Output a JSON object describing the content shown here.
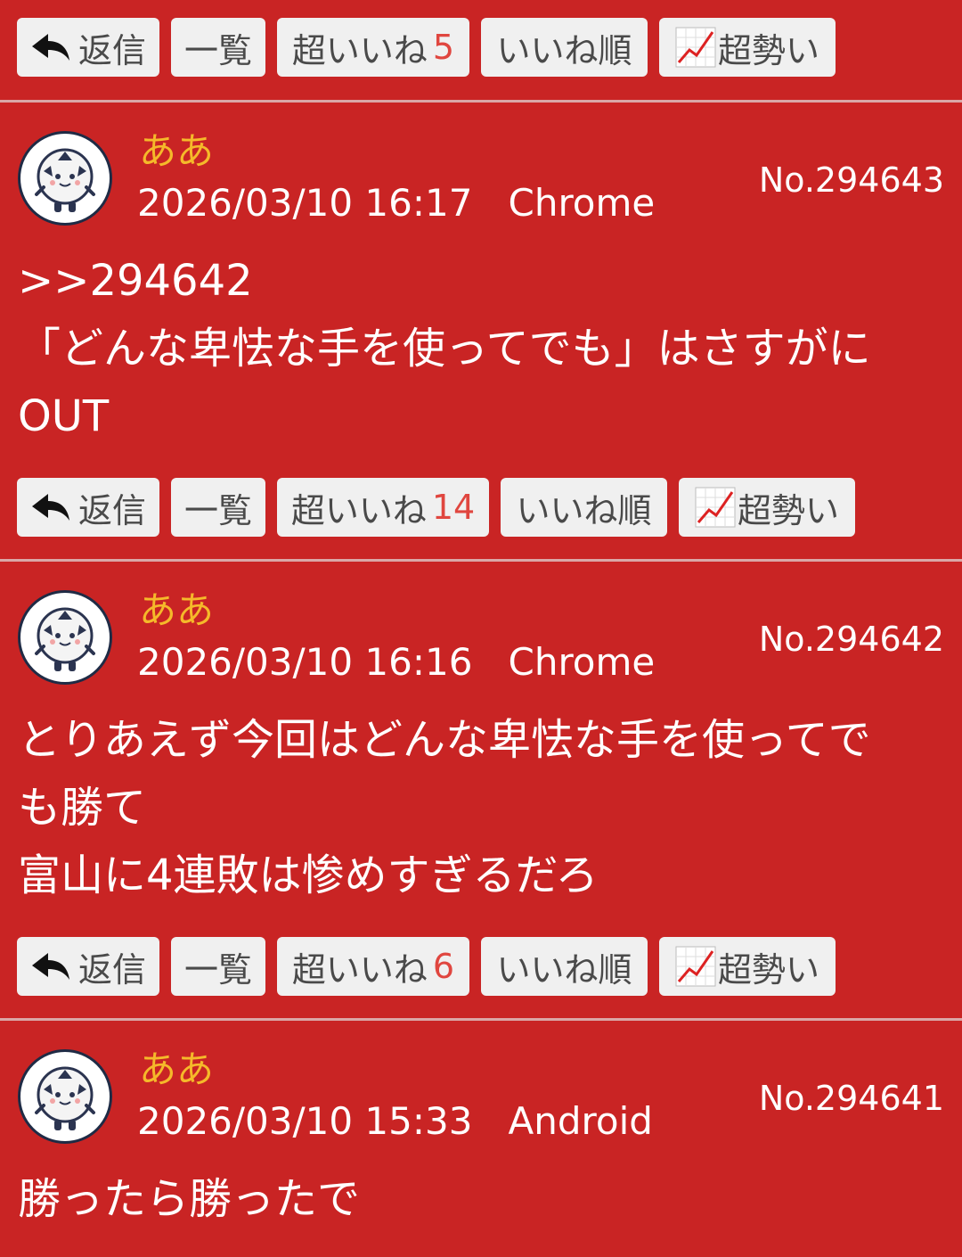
{
  "buttons": {
    "reply": "返信",
    "list": "一覧",
    "super_like": "超いいね",
    "like_order": "いいね順",
    "super_trend": "超勢い"
  },
  "top_actions": {
    "super_like_count": "5"
  },
  "posts": [
    {
      "author": "ああ",
      "meta": "2026/03/10 16:17   Chrome",
      "number": "No.294643",
      "body": [
        ">>294642",
        "「どんな卑怯な手を使ってでも」はさすがに",
        "OUT"
      ],
      "super_like_count": "14"
    },
    {
      "author": "ああ",
      "meta": "2026/03/10 16:16   Chrome",
      "number": "No.294642",
      "body": [
        "とりあえず今回はどんな卑怯な手を使ってで",
        "も勝て",
        "富山に4連敗は惨めすぎるだろ"
      ],
      "super_like_count": "6"
    },
    {
      "author": "ああ",
      "meta": "2026/03/10 15:33   Android",
      "number": "No.294641",
      "body": [
        "勝ったら勝ったで"
      ]
    }
  ],
  "icons": {
    "reply": "reply-arrow-icon",
    "trend": "trend-chart-icon",
    "avatar": "soccer-ball-mascot-avatar"
  },
  "colors": {
    "background": "#c92424",
    "author": "#f5b92a",
    "count": "#e0463f",
    "button_bg": "#f0f0f0"
  }
}
